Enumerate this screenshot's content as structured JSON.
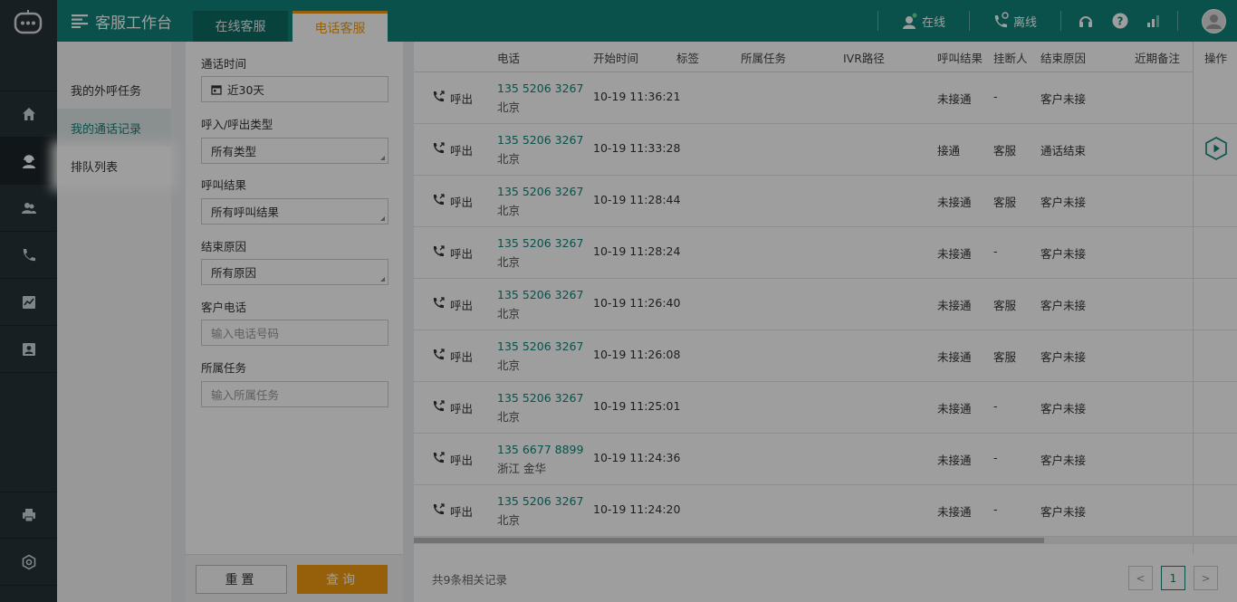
{
  "header": {
    "title": "客服工作台",
    "tabs": [
      {
        "label": "在线客服",
        "active": false
      },
      {
        "label": "电话客服",
        "active": true
      }
    ],
    "status_online": "在线",
    "status_offline": "离线",
    "icons": [
      "headset-icon",
      "help-icon",
      "signal-icon",
      "avatar-icon"
    ]
  },
  "rail": {
    "items": [
      "home-icon",
      "agent-icon",
      "contacts-icon",
      "phone-icon",
      "chart-icon",
      "profile-card-icon",
      "printer-icon",
      "settings-icon"
    ]
  },
  "submenu": {
    "items": [
      {
        "label": "我的外呼任务"
      },
      {
        "label": "我的通话记录"
      },
      {
        "label": "排队列表"
      }
    ]
  },
  "filter": {
    "call_time_label": "通话时间",
    "call_time_value": "近30天",
    "direction_label": "呼入/呼出类型",
    "direction_value": "所有类型",
    "result_label": "呼叫结果",
    "result_value": "所有呼叫结果",
    "end_reason_label": "结束原因",
    "end_reason_value": "所有原因",
    "customer_phone_label": "客户电话",
    "customer_phone_placeholder": "输入电话号码",
    "task_label": "所属任务",
    "task_placeholder": "输入所属任务",
    "reset_label": "重置",
    "query_label": "查询"
  },
  "table": {
    "columns": [
      "电话",
      "开始时间",
      "标签",
      "所属任务",
      "IVR路径",
      "呼叫结果",
      "挂断人",
      "结束原因",
      "近期备注",
      "操作"
    ],
    "rows": [
      {
        "direction": "呼出",
        "phone": "135 5206 3267",
        "city": "北京",
        "start": "10-19 11:36:21",
        "result": "未接通",
        "hangup": "-",
        "reason": "客户未接",
        "has_play": false
      },
      {
        "direction": "呼出",
        "phone": "135 5206 3267",
        "city": "北京",
        "start": "10-19 11:33:28",
        "result": "接通",
        "hangup": "客服",
        "reason": "通话结束",
        "has_play": true
      },
      {
        "direction": "呼出",
        "phone": "135 5206 3267",
        "city": "北京",
        "start": "10-19 11:28:44",
        "result": "未接通",
        "hangup": "客服",
        "reason": "客户未接",
        "has_play": false
      },
      {
        "direction": "呼出",
        "phone": "135 5206 3267",
        "city": "北京",
        "start": "10-19 11:28:24",
        "result": "未接通",
        "hangup": "-",
        "reason": "客户未接",
        "has_play": false
      },
      {
        "direction": "呼出",
        "phone": "135 5206 3267",
        "city": "北京",
        "start": "10-19 11:26:40",
        "result": "未接通",
        "hangup": "客服",
        "reason": "客户未接",
        "has_play": false
      },
      {
        "direction": "呼出",
        "phone": "135 5206 3267",
        "city": "北京",
        "start": "10-19 11:26:08",
        "result": "未接通",
        "hangup": "客服",
        "reason": "客户未接",
        "has_play": false
      },
      {
        "direction": "呼出",
        "phone": "135 5206 3267",
        "city": "北京",
        "start": "10-19 11:25:01",
        "result": "未接通",
        "hangup": "-",
        "reason": "客户未接",
        "has_play": false
      },
      {
        "direction": "呼出",
        "phone": "135 6677 8899",
        "city": "浙江 金华",
        "start": "10-19 11:24:36",
        "result": "未接通",
        "hangup": "-",
        "reason": "客户未接",
        "has_play": false
      },
      {
        "direction": "呼出",
        "phone": "135 5206 3267",
        "city": "北京",
        "start": "10-19 11:24:20",
        "result": "未接通",
        "hangup": "-",
        "reason": "客户未接",
        "has_play": false
      }
    ]
  },
  "footer": {
    "total": "共9条相关记录",
    "current_page": "1",
    "prev": "<",
    "next": ">"
  },
  "colors": {
    "brand": "#11837a",
    "accent": "#f39c12",
    "rail": "#263238"
  }
}
